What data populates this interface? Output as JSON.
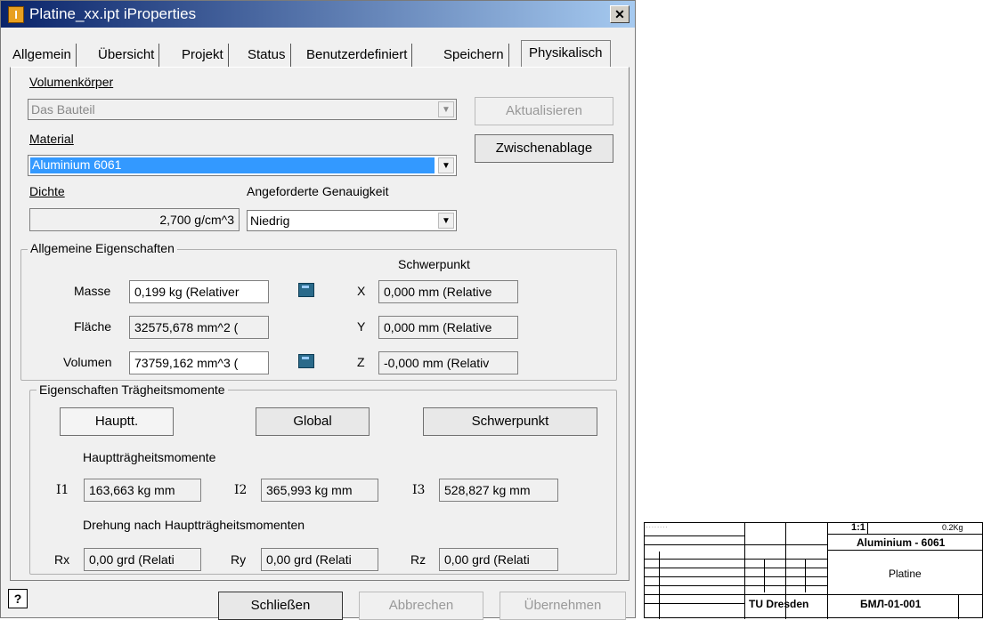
{
  "window": {
    "title": "Platine_xx.ipt iProperties",
    "close": "✕"
  },
  "tabs": [
    "Allgemein",
    "Übersicht",
    "Projekt",
    "Status",
    "Benutzerdefiniert",
    "Speichern",
    "Physikalisch"
  ],
  "solid": {
    "label": "Volumenkörper",
    "value": "Das Bauteil",
    "update_btn": "Aktualisieren"
  },
  "material": {
    "label": "Material",
    "value": "Aluminium 6061",
    "clipboard_btn": "Zwischenablage"
  },
  "density": {
    "label": "Dichte",
    "value": "2,700 g/cm^3"
  },
  "accuracy": {
    "label": "Angeforderte Genauigkeit",
    "value": "Niedrig"
  },
  "general": {
    "title": "Allgemeine Eigenschaften",
    "cog_title": "Schwerpunkt",
    "mass_label": "Masse",
    "mass": "0,199 kg (Relativer",
    "area_label": "Fläche",
    "area": "32575,678 mm^2 (",
    "volume_label": "Volumen",
    "volume": "73759,162 mm^3 (",
    "x_label": "X",
    "x": "0,000 mm (Relative",
    "y_label": "Y",
    "y": "0,000 mm (Relative",
    "z_label": "Z",
    "z": "-0,000 mm (Relativ"
  },
  "inertia": {
    "title": "Eigenschaften Trägheitsmomente",
    "btn_principal": "Hauptt.",
    "btn_global": "Global",
    "btn_cog": "Schwerpunkt",
    "moments_title": "Hauptträgheitsmomente",
    "i1_label": "I1",
    "i1": "163,663 kg mm",
    "i2_label": "I2",
    "i2": "365,993 kg mm",
    "i3_label": "I3",
    "i3": "528,827 kg mm",
    "rot_title": "Drehung nach Hauptträgheitsmomenten",
    "rx_label": "Rx",
    "rx": "0,00 grd (Relati",
    "ry_label": "Ry",
    "ry": "0,00 grd (Relati",
    "rz_label": "Rz",
    "rz": "0,00 grd (Relati"
  },
  "footer": {
    "help": "?",
    "close": "Schließen",
    "cancel": "Abbrechen",
    "apply": "Übernehmen"
  },
  "titleblock": {
    "scale": "1:1",
    "weight": "0.2Kg",
    "material": "Aluminium - 6061",
    "name": "Platine",
    "org": "TU Dresden",
    "number": "БМЛ-01-001"
  }
}
